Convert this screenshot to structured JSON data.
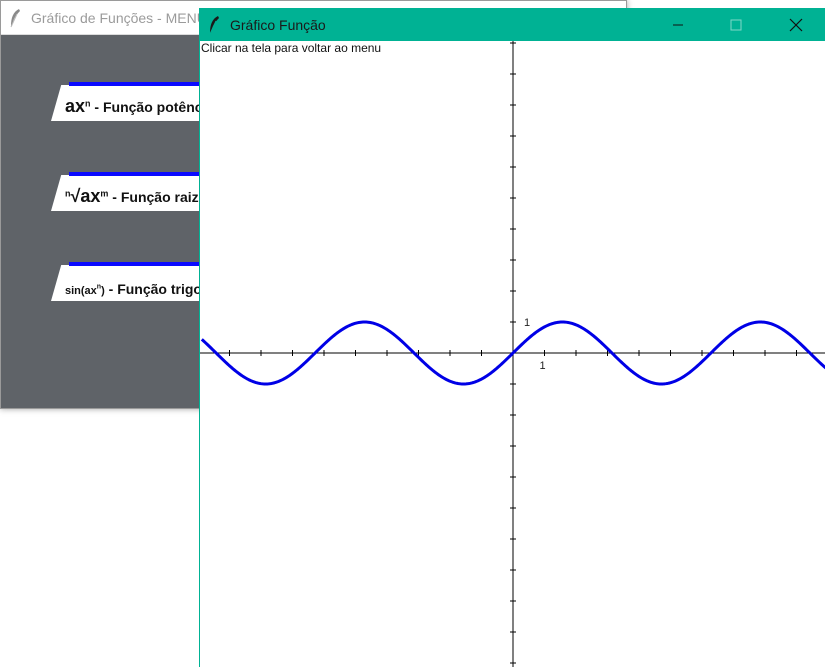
{
  "menu_window": {
    "title": "Gráfico de Funções - MENU",
    "buttons": [
      {
        "formula": "ax",
        "sup": "n",
        "label": " - Função potência"
      },
      {
        "sup_pre": "n",
        "formula": "√ax",
        "sup": "m",
        "label": " - Função raiz"
      },
      {
        "formula": "sin(ax",
        "sup": "n",
        "formula_end": ")",
        "label": " - Função trigonométrica"
      }
    ]
  },
  "graph_window": {
    "title": "Gráfico Função",
    "hint": "Clicar na tela para voltar ao menu",
    "controls": {
      "minimize": "minimize",
      "maximize": "maximize",
      "close": "close"
    }
  },
  "chart_data": {
    "type": "line",
    "function": "sin(x)",
    "series": [
      {
        "x_min": -9.88,
        "x_max": 9.94,
        "amplitude": 1,
        "frequency": 1
      }
    ],
    "tick_labels": {
      "x": "1",
      "y": "1"
    },
    "line_color": "#0000e6",
    "axis_color": "#000000",
    "grid": false
  }
}
